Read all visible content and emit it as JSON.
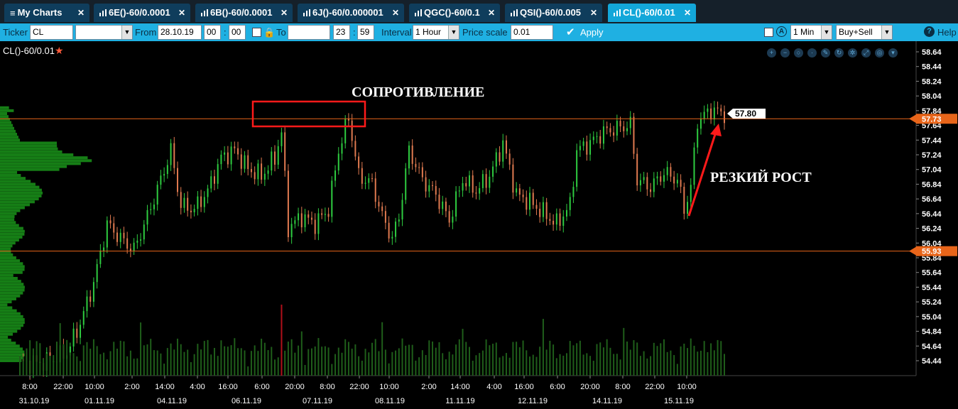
{
  "tabs": [
    {
      "label": "My Charts",
      "icon": "list-icon",
      "active": false
    },
    {
      "label": "6E()-60/0.0001",
      "icon": "bar-chart-icon",
      "active": false
    },
    {
      "label": "6B()-60/0.0001",
      "icon": "bar-chart-icon",
      "active": false
    },
    {
      "label": "6J()-60/0.000001",
      "icon": "bar-chart-icon",
      "active": false
    },
    {
      "label": "QGC()-60/0.1",
      "icon": "bar-chart-icon",
      "active": false
    },
    {
      "label": "QSI()-60/0.005",
      "icon": "bar-chart-icon",
      "active": false
    },
    {
      "label": "CL()-60/0.01",
      "icon": "bar-chart-icon",
      "active": true
    }
  ],
  "toolbar": {
    "ticker_label": "Ticker",
    "ticker_value": "CL",
    "from_label": "From",
    "from_date": "28.10.19",
    "from_hour": "00",
    "from_min": "00",
    "to_label": "To",
    "to_date": "",
    "to_hour": "23",
    "to_min": "59",
    "interval_label": "Interval",
    "interval_value": "1 Hour",
    "price_scale_label": "Price scale",
    "price_scale_value": "0.01",
    "apply_label": "Apply",
    "min_value": "1 Min",
    "side_value": "Buy+Sell",
    "help_label": "Help",
    "colon": ":"
  },
  "chart": {
    "title": "CL()-60/0.01",
    "annotation_resistance": "СОПРОТИВЛЕНИЕ",
    "annotation_rally": "РЕЗКИЙ РОСТ",
    "last_price_label": "57.80",
    "line_upper_label": "57.73",
    "line_lower_label": "55.93",
    "colors": {
      "up_candle": "#2ecc40",
      "down_candle": "#e07a50",
      "level_line": "#e8651a",
      "volume": "#1f5e1a",
      "profile": "#1ea81e",
      "annotation_box": "#ff1a1a"
    }
  },
  "chart_data": {
    "type": "candlestick",
    "title": "CL()-60/0.01",
    "y_ticks": [
      "58.64",
      "58.44",
      "58.24",
      "58.04",
      "57.84",
      "57.64",
      "57.44",
      "57.24",
      "57.04",
      "56.84",
      "56.64",
      "56.44",
      "56.24",
      "56.04",
      "55.84",
      "55.64",
      "55.44",
      "55.24",
      "55.04",
      "54.84",
      "54.64",
      "54.44"
    ],
    "ylim": [
      54.34,
      58.74
    ],
    "x_time_ticks": [
      "8:00",
      "22:00",
      "10:00",
      "2:00",
      "14:00",
      "4:00",
      "16:00",
      "6:00",
      "20:00",
      "8:00",
      "22:00",
      "10:00",
      "2:00",
      "14:00",
      "4:00",
      "16:00",
      "6:00",
      "20:00",
      "8:00",
      "22:00",
      "10:00"
    ],
    "x_date_ticks": [
      "31.10.19",
      "01.11.19",
      "04.11.19",
      "06.11.19",
      "07.11.19",
      "08.11.19",
      "11.11.19",
      "12.11.19",
      "14.11.19",
      "15.11.19"
    ],
    "horizontal_levels": [
      57.73,
      55.93
    ],
    "last_price": 57.8,
    "close_path": [
      {
        "i": 0,
        "p": 54.4
      },
      {
        "i": 8,
        "p": 54.42
      },
      {
        "i": 14,
        "p": 54.55
      },
      {
        "i": 18,
        "p": 54.95
      },
      {
        "i": 22,
        "p": 55.5
      },
      {
        "i": 26,
        "p": 56.3
      },
      {
        "i": 30,
        "p": 56.1
      },
      {
        "i": 34,
        "p": 55.95
      },
      {
        "i": 38,
        "p": 56.4
      },
      {
        "i": 42,
        "p": 56.9
      },
      {
        "i": 45,
        "p": 57.3
      },
      {
        "i": 48,
        "p": 56.55
      },
      {
        "i": 52,
        "p": 56.5
      },
      {
        "i": 56,
        "p": 56.75
      },
      {
        "i": 60,
        "p": 57.2
      },
      {
        "i": 64,
        "p": 57.3
      },
      {
        "i": 68,
        "p": 57.05
      },
      {
        "i": 72,
        "p": 56.95
      },
      {
        "i": 76,
        "p": 57.2
      },
      {
        "i": 78,
        "p": 57.55
      },
      {
        "i": 80,
        "p": 56.25
      },
      {
        "i": 84,
        "p": 56.4
      },
      {
        "i": 88,
        "p": 56.3
      },
      {
        "i": 92,
        "p": 56.5
      },
      {
        "i": 95,
        "p": 57.3
      },
      {
        "i": 98,
        "p": 57.75
      },
      {
        "i": 101,
        "p": 56.95
      },
      {
        "i": 105,
        "p": 56.85
      },
      {
        "i": 108,
        "p": 56.4
      },
      {
        "i": 111,
        "p": 56.1
      },
      {
        "i": 113,
        "p": 56.4
      },
      {
        "i": 116,
        "p": 57.3
      },
      {
        "i": 120,
        "p": 56.9
      },
      {
        "i": 124,
        "p": 56.7
      },
      {
        "i": 128,
        "p": 56.35
      },
      {
        "i": 132,
        "p": 56.9
      },
      {
        "i": 136,
        "p": 56.75
      },
      {
        "i": 140,
        "p": 56.95
      },
      {
        "i": 144,
        "p": 57.4
      },
      {
        "i": 148,
        "p": 56.7
      },
      {
        "i": 152,
        "p": 56.6
      },
      {
        "i": 156,
        "p": 56.45
      },
      {
        "i": 160,
        "p": 56.3
      },
      {
        "i": 164,
        "p": 56.55
      },
      {
        "i": 166,
        "p": 57.3
      },
      {
        "i": 170,
        "p": 57.4
      },
      {
        "i": 174,
        "p": 57.55
      },
      {
        "i": 178,
        "p": 57.6
      },
      {
        "i": 182,
        "p": 57.65
      },
      {
        "i": 184,
        "p": 56.9
      },
      {
        "i": 188,
        "p": 56.8
      },
      {
        "i": 192,
        "p": 57.0
      },
      {
        "i": 196,
        "p": 56.9
      },
      {
        "i": 198,
        "p": 56.5
      },
      {
        "i": 200,
        "p": 56.8
      },
      {
        "i": 202,
        "p": 57.7
      },
      {
        "i": 206,
        "p": 57.85
      },
      {
        "i": 210,
        "p": 57.8
      }
    ]
  }
}
